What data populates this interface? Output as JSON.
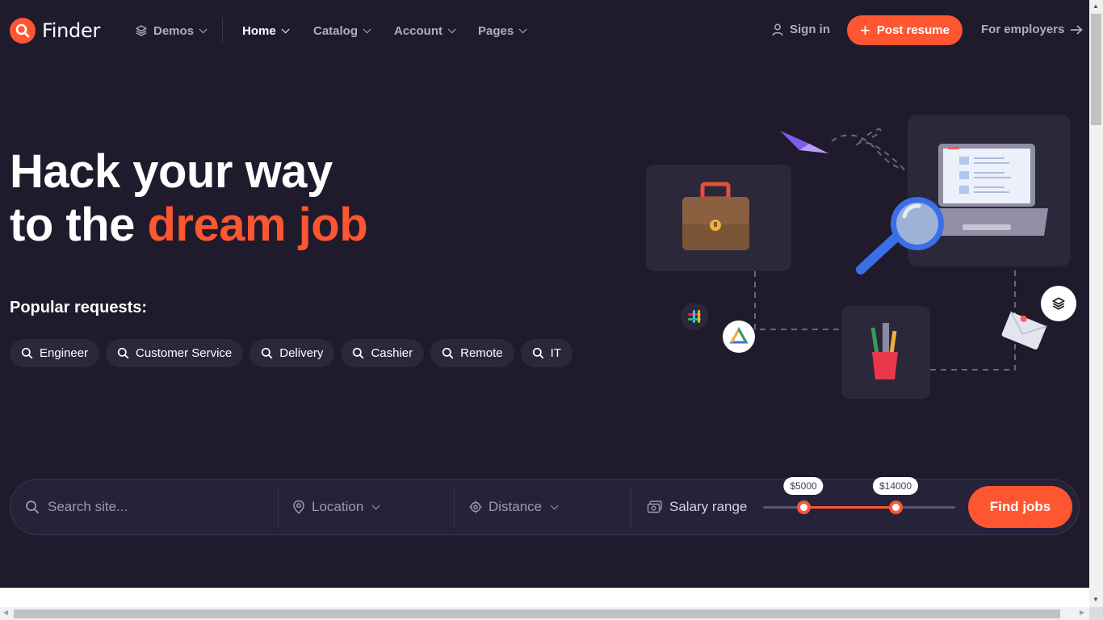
{
  "brand": {
    "name": "Finder",
    "color": "#fd5631"
  },
  "nav": {
    "demos": "Demos",
    "home": "Home",
    "catalog": "Catalog",
    "account": "Account",
    "pages": "Pages"
  },
  "header_actions": {
    "sign_in": "Sign in",
    "post_resume": "Post resume",
    "for_employers": "For employers"
  },
  "hero": {
    "title_line1": "Hack your way",
    "title_line2_prefix": "to the ",
    "title_line2_accent": "dream job",
    "popular_label": "Popular requests:"
  },
  "popular_requests": [
    "Engineer",
    "Customer Service",
    "Delivery",
    "Cashier",
    "Remote",
    "IT"
  ],
  "search": {
    "placeholder": "Search site...",
    "location": "Location",
    "distance": "Distance",
    "salary_label": "Salary range",
    "salary_min": "$5000",
    "salary_max": "$14000",
    "salary_min_fraction": 0.21,
    "salary_max_fraction": 0.69,
    "submit": "Find jobs"
  },
  "icons": [
    "search-icon",
    "layers-icon",
    "user-icon",
    "plus-icon",
    "arrow-right-icon",
    "map-pin-icon",
    "target-icon",
    "cash-icon"
  ]
}
